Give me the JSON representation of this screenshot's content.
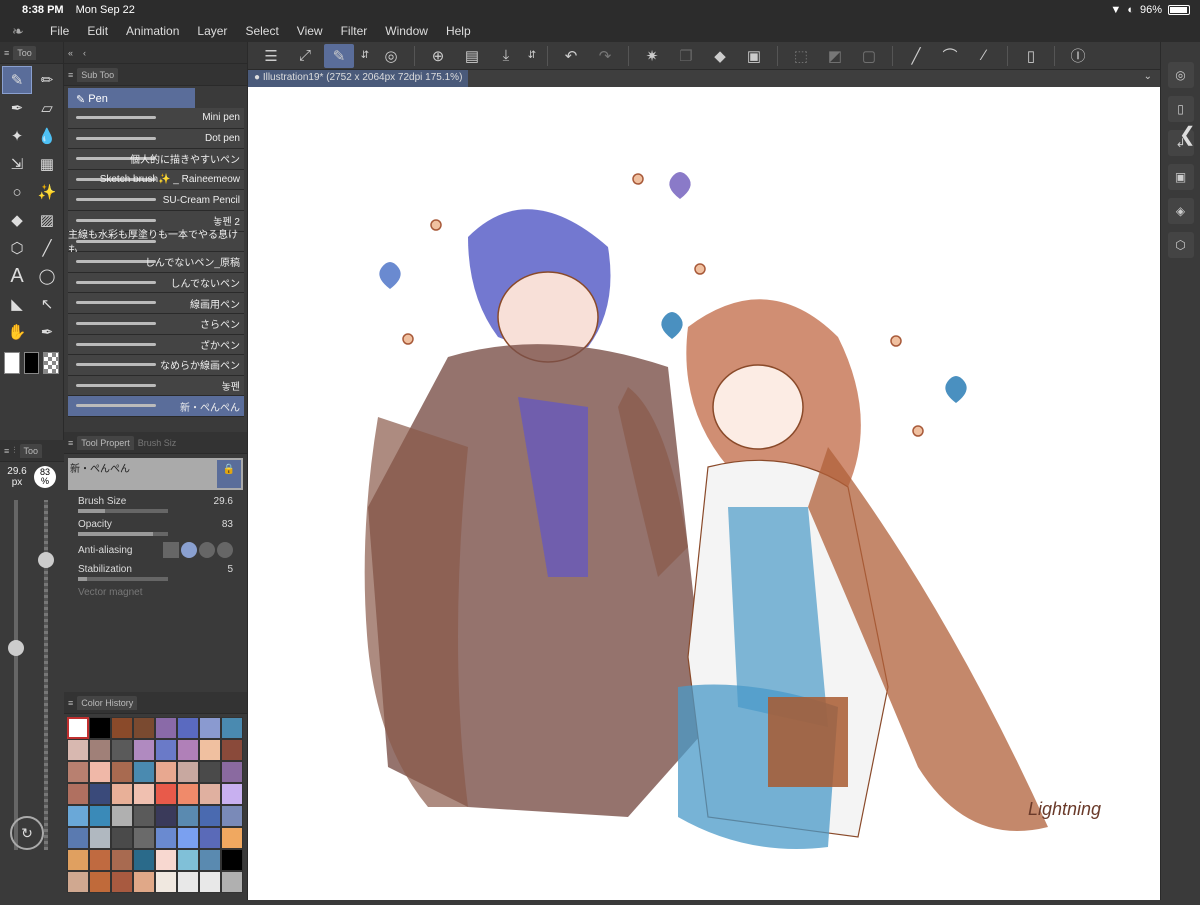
{
  "status": {
    "time": "8:38 PM",
    "date": "Mon Sep 22",
    "battery": "96%"
  },
  "menu": [
    "File",
    "Edit",
    "Animation",
    "Layer",
    "Select",
    "View",
    "Filter",
    "Window",
    "Help"
  ],
  "document": {
    "tab_title": "Illustration19* (2752 x 2064px 72dpi 175.1%)"
  },
  "tool_panel": {
    "tab_label": "Too"
  },
  "sub_tool": {
    "tab_label": "Sub Too",
    "selected_group": "Pen",
    "brushes": [
      "Mini pen",
      "Dot pen",
      "個人的に描きやすいペン",
      "Sketch brush✨ _ Raineemeow",
      "SU-Cream Pencil",
      "놓펜 2",
      "主線も水彩も厚塗りも一本でやる息けも",
      "しんでないペン_原稿",
      "しんでないペン",
      "線画用ペン",
      "さらペン",
      "ざかペン",
      "なめらか線画ペン",
      "놓펜",
      "新・ぺんぺん"
    ]
  },
  "size_panel": {
    "tab_label": "Too",
    "size_value": "29.6",
    "size_unit": "px",
    "opacity_value": "83",
    "opacity_unit": "%"
  },
  "tool_property": {
    "tab_label": "Tool Propert",
    "tab2_label": "Brush Siz",
    "brush_name": "新・ぺんぺん",
    "brush_size_label": "Brush Size",
    "brush_size_value": "29.6",
    "opacity_label": "Opacity",
    "opacity_value": "83",
    "anti_aliasing_label": "Anti-aliasing",
    "stabilization_label": "Stabilization",
    "stabilization_value": "5",
    "vector_magnet_label": "Vector magnet"
  },
  "color_panel": {
    "tab_label": "Color History",
    "swatches": [
      "#ffffff",
      "#000000",
      "#8a4a2a",
      "#7a4a30",
      "#8a6aa8",
      "#5a6ac0",
      "#8a9ad0",
      "#4a8ab0",
      "#d8b8b0",
      "#a08078",
      "#5a5a5a",
      "#b08ac0",
      "#6a7ac8",
      "#b080b8",
      "#f0c0a0",
      "#8a4a3a",
      "#b88070",
      "#f0b8a8",
      "#a86a50",
      "#4a8ab0",
      "#e8a890",
      "#c8a8a0",
      "#4a4a4a",
      "#8a6aa0",
      "#b07060",
      "#3a4a7a",
      "#e8b098",
      "#f0c0b0",
      "#e85a4a",
      "#f08a6a",
      "#e0b0a0",
      "#c8b0f0",
      "#6aa8d8",
      "#3a8ab8",
      "#b0b0b0",
      "#5a5a5a",
      "#3a3a5a",
      "#5a8ab0",
      "#4a6ab0",
      "#7a8ab8",
      "#5a7ab0",
      "#b0b8c0",
      "#4a4a4a",
      "#6a6a6a",
      "#6a8ad0",
      "#7aa0f0",
      "#5a6ab8",
      "#f0a860",
      "#e0a060",
      "#c06a40",
      "#a86a50",
      "#2a6a8a",
      "#f8d8d0",
      "#80c0d8",
      "#5a8ab0",
      "#000000",
      "#d0a890",
      "#c06a3a",
      "#a85a40",
      "#e0a888",
      "#f0e8e0",
      "#e8e8e8",
      "#e8e8e8",
      "#b0b0b0"
    ]
  },
  "colors": {
    "accent": "#5a6d9a",
    "panel_bg": "#3a3a3a",
    "canvas_bg": "#ffffff"
  },
  "signature": "Lightning"
}
